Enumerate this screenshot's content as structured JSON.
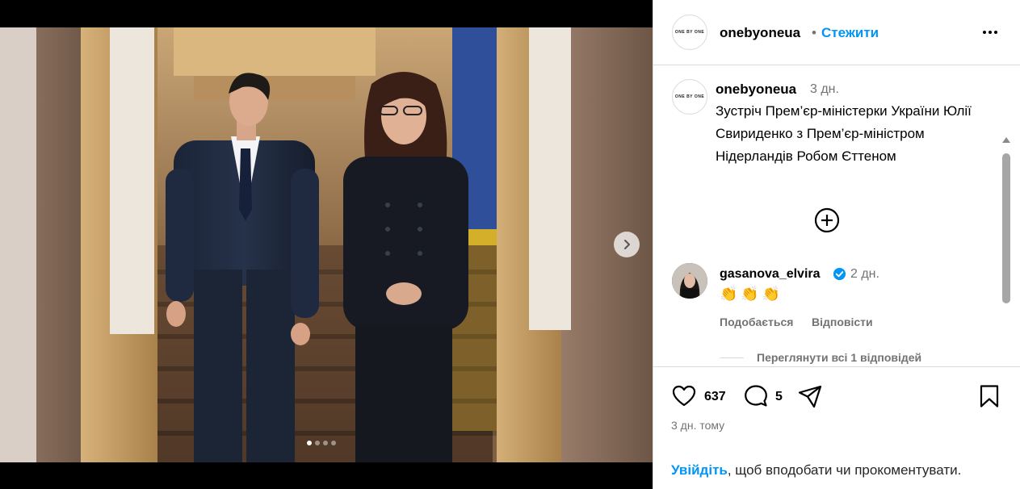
{
  "header": {
    "avatar_text": "ONE BY ONE",
    "username": "onebyoneua",
    "separator": "•",
    "follow_label": "Стежити"
  },
  "caption": {
    "avatar_text": "ONE BY ONE",
    "username": "onebyoneua",
    "time": "3 дн.",
    "text": "Зустріч Прем’єр-міністерки України Юлії Свириденко з Прем’єр-міністром Нідерландів Робом Єттеном"
  },
  "comment": {
    "username": "gasanova_elvira",
    "time": "2 дн.",
    "text": "👏👏👏",
    "like_label": "Подобається",
    "reply_label": "Відповісти",
    "view_replies_label": "Переглянути всі 1 відповідей"
  },
  "actions": {
    "likes": "637",
    "comments": "5",
    "post_time": "3 дн. тому"
  },
  "login": {
    "link_label": "Увійдіть",
    "rest_text": ", щоб вподобати чи прокоментувати."
  },
  "carousel": {
    "total": 4,
    "active": 1
  },
  "colors": {
    "accent": "#0095f6",
    "muted": "#737373",
    "border": "#dbdbdb"
  }
}
